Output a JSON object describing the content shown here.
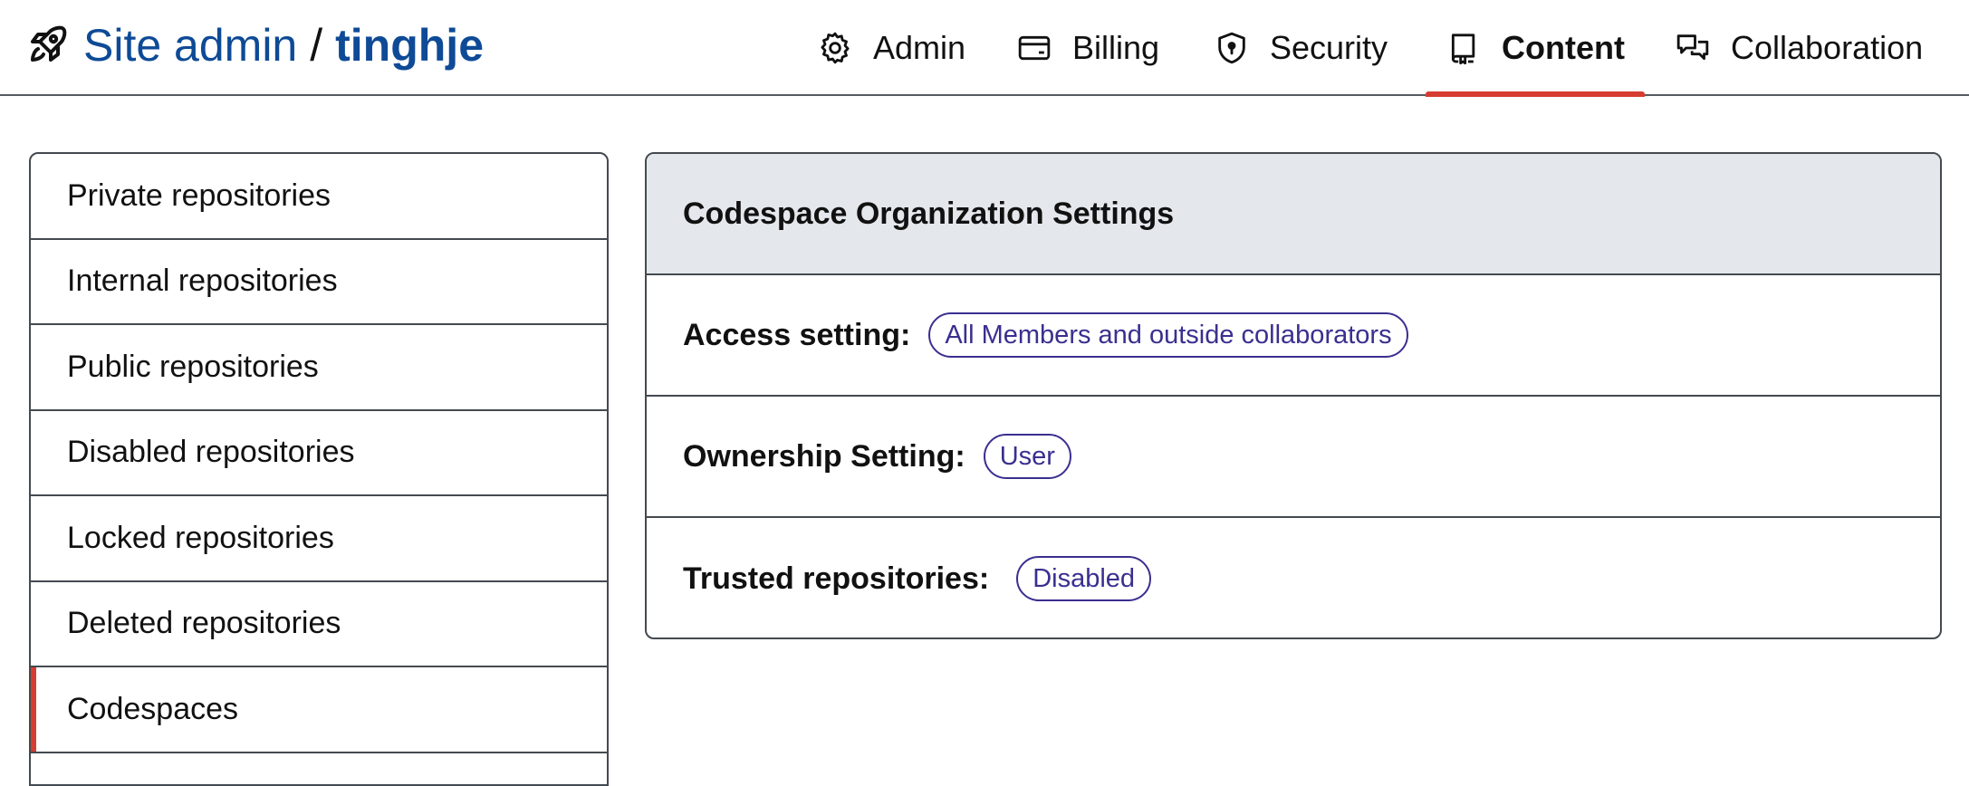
{
  "header": {
    "site_admin": "Site admin",
    "separator": "/",
    "org": "tinghje"
  },
  "nav": [
    {
      "label": "Admin",
      "icon": "gear-icon"
    },
    {
      "label": "Billing",
      "icon": "credit-card-icon"
    },
    {
      "label": "Security",
      "icon": "shield-lock-icon"
    },
    {
      "label": "Content",
      "icon": "repo-icon",
      "active": true
    },
    {
      "label": "Collaboration",
      "icon": "comment-discussion-icon"
    }
  ],
  "sidebar": {
    "items": [
      {
        "label": "Private repositories"
      },
      {
        "label": "Internal repositories"
      },
      {
        "label": "Public repositories"
      },
      {
        "label": "Disabled repositories"
      },
      {
        "label": "Locked repositories"
      },
      {
        "label": "Deleted repositories"
      },
      {
        "label": "Codespaces",
        "active": true
      }
    ]
  },
  "panel": {
    "title": "Codespace Organization Settings",
    "rows": [
      {
        "label": "Access setting:",
        "value": "All Members and outside collaborators"
      },
      {
        "label": "Ownership Setting:",
        "value": "User"
      },
      {
        "label": "Trusted repositories:",
        "value": "Disabled"
      }
    ]
  },
  "colors": {
    "brand_blue": "#0e4a96",
    "accent_red": "#d63c2f",
    "pill_purple": "#3a2f8f",
    "panel_header_bg": "#e4e7eb"
  }
}
